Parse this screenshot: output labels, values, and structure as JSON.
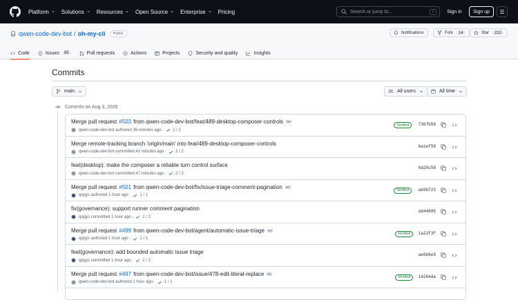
{
  "header": {
    "nav": [
      {
        "label": "Platform",
        "dropdown": true
      },
      {
        "label": "Solutions",
        "dropdown": true
      },
      {
        "label": "Resources",
        "dropdown": true
      },
      {
        "label": "Open Source",
        "dropdown": true
      },
      {
        "label": "Enterprise",
        "dropdown": true
      },
      {
        "label": "Pricing",
        "dropdown": false
      }
    ],
    "search_placeholder": "Search or jump to...",
    "search_key": "/",
    "sign_in": "Sign in",
    "sign_up": "Sign up"
  },
  "repo": {
    "owner": "qwen-code-dev-bot",
    "separator": "/",
    "name": "oh-my-cli",
    "visibility": "Public",
    "notifications_label": "Notifications",
    "fork_label": "Fork",
    "fork_count": "14",
    "star_label": "Star",
    "star_count": "222"
  },
  "tabs": [
    {
      "label": "Code",
      "icon": "code-icon"
    },
    {
      "label": "Issues",
      "icon": "issue-icon",
      "count": "65"
    },
    {
      "label": "Pull requests",
      "icon": "pull-request-icon"
    },
    {
      "label": "Actions",
      "icon": "play-icon"
    },
    {
      "label": "Projects",
      "icon": "table-icon"
    },
    {
      "label": "Security and quality",
      "icon": "shield-icon"
    },
    {
      "label": "Insights",
      "icon": "graph-icon"
    }
  ],
  "main": {
    "title": "Commits",
    "branch": "main",
    "users_filter": "All users",
    "time_filter": "All time",
    "day_label": "Commits on Aug 3, 2026"
  },
  "commits": [
    {
      "prefix": "Merge pull request",
      "pr": "#503",
      "rest": "from qwen-code-dev-bot/feat/489-desktop-composer-controls",
      "ellipsis": true,
      "author": "qwen-code-dev-bot",
      "avatar": "bot",
      "action": "authored",
      "time": "36 minutes ago",
      "checks": "1 / 1",
      "verified": "Verified",
      "sha": "7367b56"
    },
    {
      "prefix": "Merge remote-tracking branch 'origin/main' into feat/489-desktop-composer-controls",
      "pr": "",
      "rest": "",
      "ellipsis": false,
      "author": "qwen-code-dev-bot",
      "avatar": "bot",
      "action": "committed",
      "time": "41 minutes ago",
      "checks": "2 / 2",
      "verified": "",
      "sha": "6a1ef58"
    },
    {
      "prefix": "feat(desktop): make the composer a reliable turn control surface",
      "pr": "",
      "rest": "",
      "ellipsis": false,
      "author": "qwen-code-dev-bot",
      "avatar": "bot",
      "action": "committed",
      "time": "47 minutes ago",
      "checks": "2 / 2",
      "verified": "",
      "sha": "6d25c58"
    },
    {
      "prefix": "Merge pull request",
      "pr": "#501",
      "rest": "from qwen-code-dev-bot/fix/issue-triage-comment-pagination",
      "ellipsis": true,
      "author": "qqqys",
      "avatar": "q",
      "action": "authored",
      "time": "1 hour ago",
      "checks": "1 / 1",
      "verified": "Verified",
      "sha": "ab96723"
    },
    {
      "prefix": "fix(governance): support runner comment pagination",
      "pr": "",
      "rest": "",
      "ellipsis": false,
      "author": "qqqys",
      "avatar": "q",
      "action": "committed",
      "time": "1 hour ago",
      "checks": "2 / 2",
      "verified": "",
      "sha": "dd44695"
    },
    {
      "prefix": "Merge pull request",
      "pr": "#499",
      "rest": "from qwen-code-dev-bot/agent/automatic-issue-triage",
      "ellipsis": true,
      "author": "qqqys",
      "avatar": "q",
      "action": "authored",
      "time": "1 hour ago",
      "checks": "1 / 1",
      "verified": "Verified",
      "sha": "1a22f3f"
    },
    {
      "prefix": "feat(governance): add bounded automatic issue triage",
      "pr": "",
      "rest": "",
      "ellipsis": false,
      "author": "qqqys",
      "avatar": "q",
      "action": "committed",
      "time": "1 hour ago",
      "checks": "2 / 2",
      "verified": "",
      "sha": "ae6b6e5"
    },
    {
      "prefix": "Merge pull request",
      "pr": "#497",
      "rest": "from qwen-code-dev-bot/issue/478-edit-literal-replace",
      "ellipsis": true,
      "author": "qwen-code-dev-bot",
      "avatar": "bot",
      "action": "authored",
      "time": "1 hour ago",
      "checks": "1 / 1",
      "verified": "Verified",
      "sha": "14264da"
    }
  ]
}
